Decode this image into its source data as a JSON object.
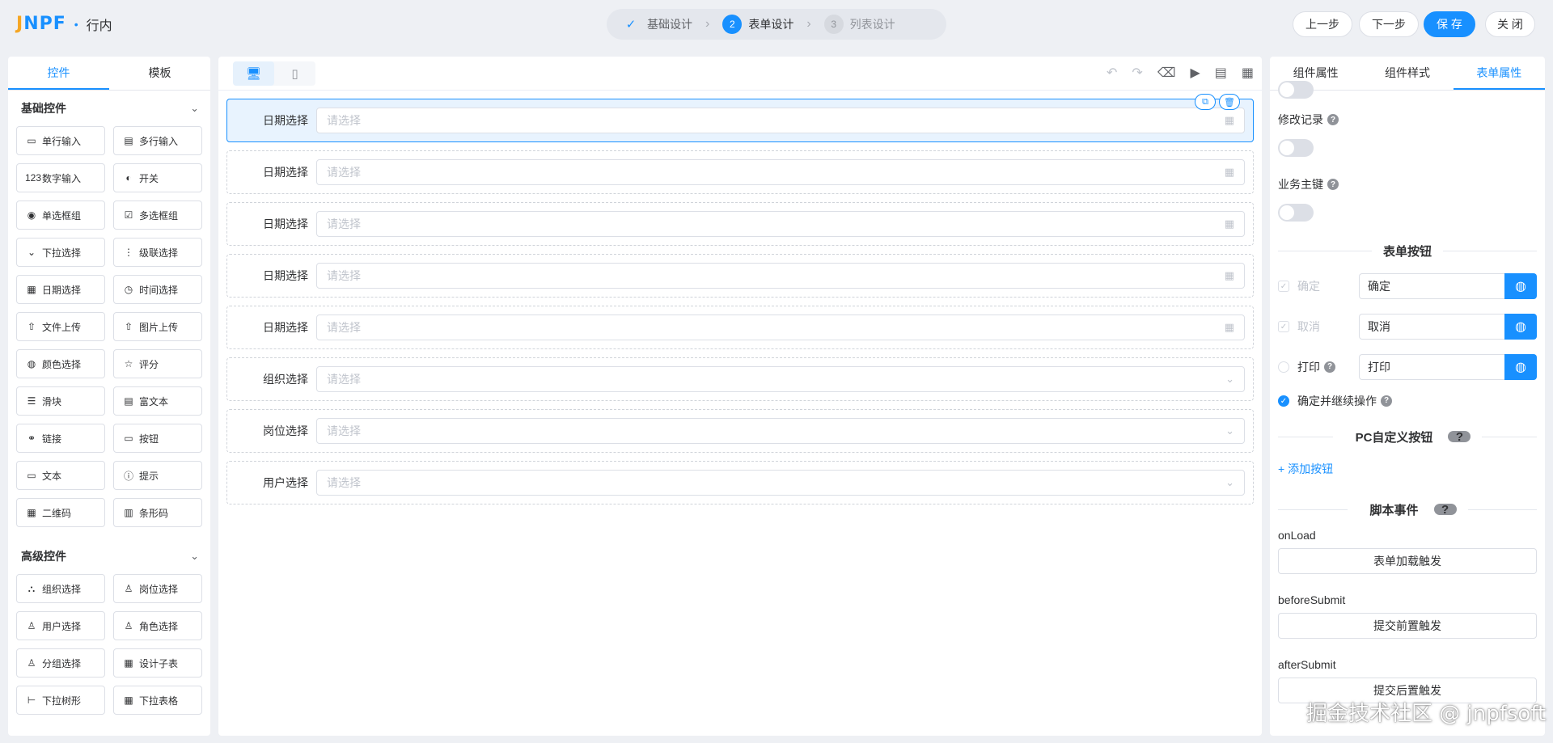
{
  "app": {
    "logo": "JNPF",
    "logo_sub": "行内"
  },
  "steps": [
    {
      "num": "✓",
      "label": "基础设计",
      "state": "done"
    },
    {
      "num": "2",
      "label": "表单设计",
      "state": "active"
    },
    {
      "num": "3",
      "label": "列表设计",
      "state": "wait"
    }
  ],
  "header_buttons": {
    "prev": "上一步",
    "next": "下一步",
    "save": "保 存",
    "close": "关 闭"
  },
  "left_panel": {
    "tabs": [
      "控件",
      "模板"
    ],
    "basic_title": "基础控件",
    "basic_items": [
      {
        "icon": "▭",
        "label": "单行输入"
      },
      {
        "icon": "▤",
        "label": "多行输入"
      },
      {
        "icon": "123",
        "label": "数字输入"
      },
      {
        "icon": "◐",
        "label": "开关"
      },
      {
        "icon": "◉",
        "label": "单选框组"
      },
      {
        "icon": "☑",
        "label": "多选框组"
      },
      {
        "icon": "⌄",
        "label": "下拉选择"
      },
      {
        "icon": "⋮",
        "label": "级联选择"
      },
      {
        "icon": "▦",
        "label": "日期选择"
      },
      {
        "icon": "◷",
        "label": "时间选择"
      },
      {
        "icon": "⇧",
        "label": "文件上传"
      },
      {
        "icon": "⇧",
        "label": "图片上传"
      },
      {
        "icon": "◍",
        "label": "颜色选择"
      },
      {
        "icon": "☆",
        "label": "评分"
      },
      {
        "icon": "☰",
        "label": "滑块"
      },
      {
        "icon": "▤",
        "label": "富文本"
      },
      {
        "icon": "⚭",
        "label": "链接"
      },
      {
        "icon": "▭",
        "label": "按钮"
      },
      {
        "icon": "▭",
        "label": "文本"
      },
      {
        "icon": "ⓘ",
        "label": "提示"
      },
      {
        "icon": "▦",
        "label": "二维码"
      },
      {
        "icon": "▥",
        "label": "条形码"
      }
    ],
    "advanced_title": "高级控件",
    "advanced_items": [
      {
        "icon": "⛬",
        "label": "组织选择"
      },
      {
        "icon": "♙",
        "label": "岗位选择"
      },
      {
        "icon": "♙",
        "label": "用户选择"
      },
      {
        "icon": "♙",
        "label": "角色选择"
      },
      {
        "icon": "♙",
        "label": "分组选择"
      },
      {
        "icon": "▦",
        "label": "设计子表"
      },
      {
        "icon": "⊢",
        "label": "下拉树形"
      },
      {
        "icon": "▦",
        "label": "下拉表格"
      }
    ]
  },
  "canvas": {
    "items": [
      {
        "label": "日期选择",
        "placeholder": "请选择",
        "suffix": "▦"
      },
      {
        "label": "日期选择",
        "placeholder": "请选择",
        "suffix": "▦"
      },
      {
        "label": "日期选择",
        "placeholder": "请选择",
        "suffix": "▦"
      },
      {
        "label": "日期选择",
        "placeholder": "请选择",
        "suffix": "▦"
      },
      {
        "label": "日期选择",
        "placeholder": "请选择",
        "suffix": "▦"
      },
      {
        "label": "组织选择",
        "placeholder": "请选择",
        "suffix": "⌄"
      },
      {
        "label": "岗位选择",
        "placeholder": "请选择",
        "suffix": "⌄"
      },
      {
        "label": "用户选择",
        "placeholder": "请选择",
        "suffix": "⌄"
      }
    ]
  },
  "right_panel": {
    "tabs": [
      "组件属性",
      "组件样式",
      "表单属性"
    ],
    "modify_record": "修改记录",
    "business_key": "业务主键",
    "form_buttons_title": "表单按钮",
    "buttons": [
      {
        "label": "确定",
        "value": "确定"
      },
      {
        "label": "取消",
        "value": "取消"
      },
      {
        "label": "打印",
        "value": "打印"
      }
    ],
    "confirm_continue": "确定并继续操作",
    "pc_custom_title": "PC自定义按钮",
    "add_button": "+ 添加按钮",
    "script_title": "脚本事件",
    "events": [
      {
        "name": "onLoad",
        "button": "表单加载触发"
      },
      {
        "name": "beforeSubmit",
        "button": "提交前置触发"
      },
      {
        "name": "afterSubmit",
        "button": "提交后置触发"
      }
    ]
  },
  "watermark": "掘金技术社区 @ jnpfsoft",
  "colors": {
    "accent": "#1890ff",
    "logo_orange": "#f5a623"
  }
}
